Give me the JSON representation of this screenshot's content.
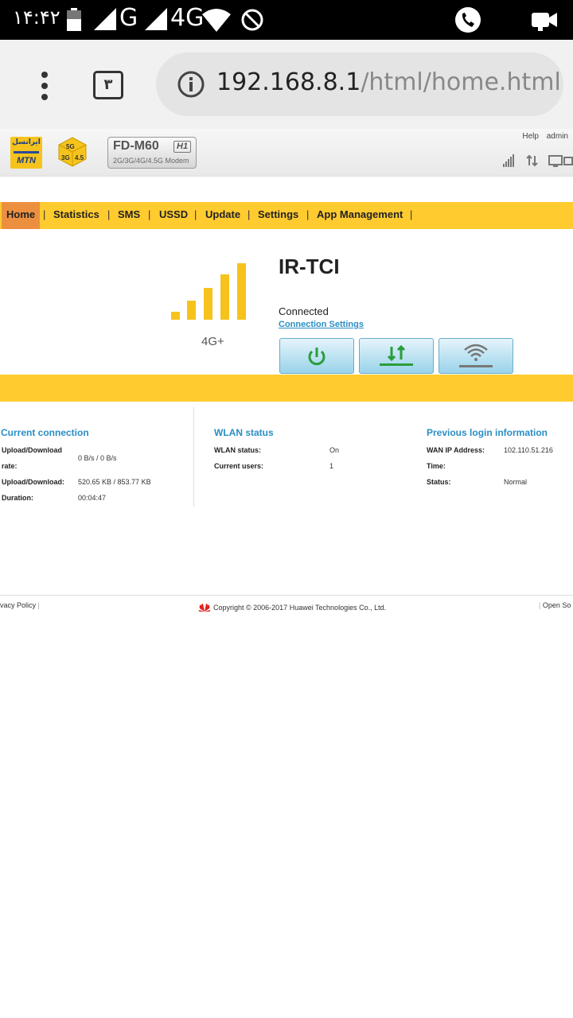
{
  "status_bar": {
    "time": "۱۴:۴۲",
    "network_label_1": "G",
    "network_label_2": "4G"
  },
  "browser": {
    "tab_count": "۳",
    "url_host": "192.168.8.1",
    "url_path": "/html/home.html"
  },
  "router_header": {
    "brand_fa": "ایرانسل",
    "brand_en": "MTN",
    "model_name": "FD-M60",
    "model_rev": "H1",
    "model_sub": "2G/3G/4G/4.5G Modem",
    "help_link": "Help",
    "user_link": "admin"
  },
  "nav": {
    "items": [
      "Home",
      "Statistics",
      "SMS",
      "USSD",
      "Update",
      "Settings",
      "App Management"
    ],
    "active": "Home"
  },
  "connection": {
    "operator": "IR-TCI",
    "network_type": "4G+",
    "status": "Connected",
    "settings_link": "Connection Settings",
    "signal_bars": 5
  },
  "current_connection": {
    "title": "Current connection",
    "rate_label_1": "Upload/Download",
    "rate_label_2": "rate:",
    "rate_value": "0 B/s / 0 B/s",
    "volume_label": "Upload/Download:",
    "volume_value": "520.65 KB / 853.77 KB",
    "duration_label": "Duration:",
    "duration_value": "00:04:47"
  },
  "wlan_status": {
    "title": "WLAN status",
    "status_label": "WLAN status:",
    "status_value": "On",
    "users_label": "Current users:",
    "users_value": "1"
  },
  "previous_login": {
    "title": "Previous login information",
    "wan_label": "WAN IP Address:",
    "wan_value": "102.110.51.216",
    "time_label": "Time:",
    "status_label": "Status:",
    "status_value": "Normal"
  },
  "footer": {
    "privacy": "vacy Policy",
    "copyright": "Copyright © 2006-2017 Huawei Technologies Co., Ltd.",
    "open_source": "Open So"
  },
  "colors": {
    "nav_yellow": "#ffcb2f",
    "nav_active": "#ec9040",
    "link_blue": "#2a8ec4",
    "signal_yellow": "#f6c31c"
  }
}
